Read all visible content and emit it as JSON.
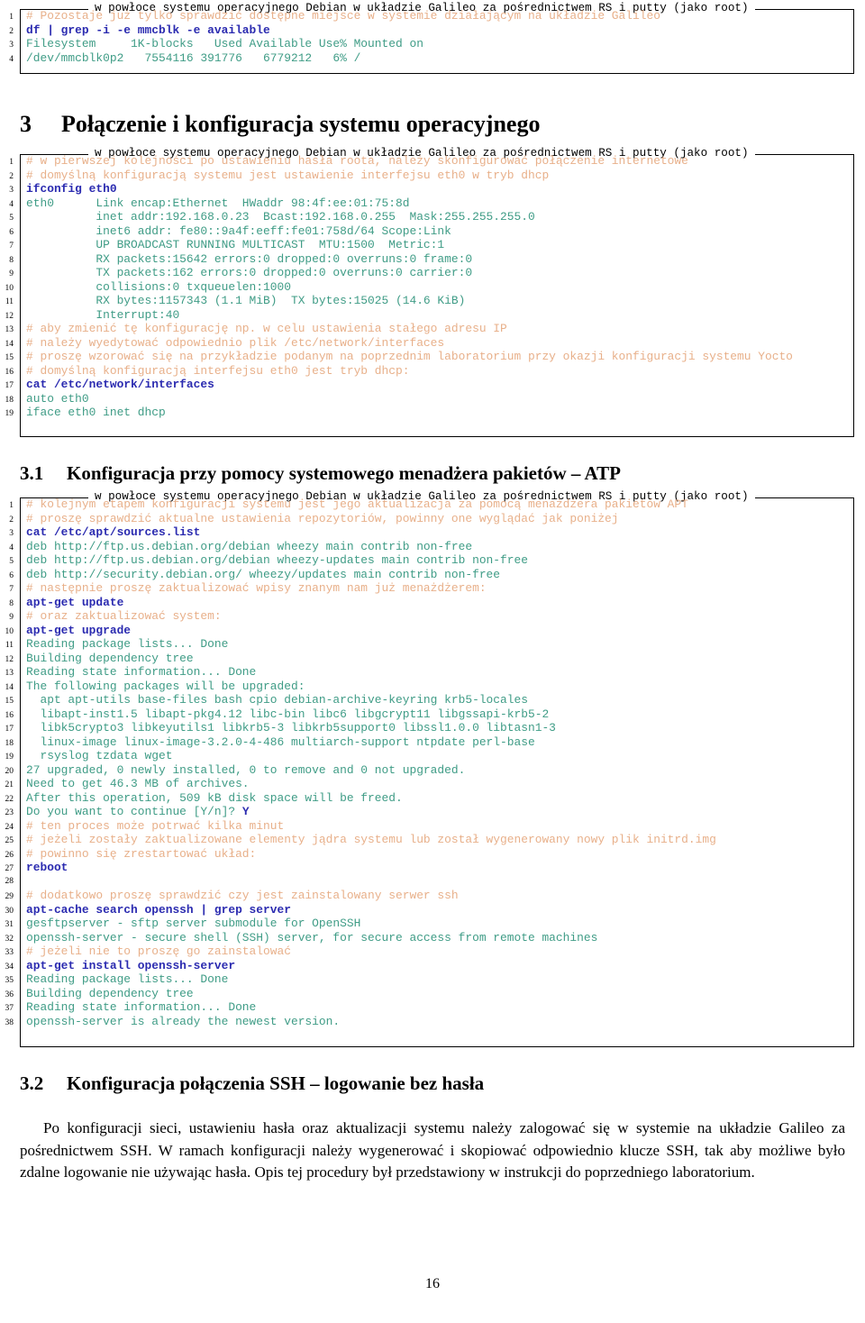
{
  "document": {
    "page_number": "16",
    "colors": {
      "comment": "#e8b08a",
      "command": "#2b2bb0",
      "output": "#3f9c86",
      "frame": "#000000",
      "text": "#000000"
    }
  },
  "listing_caption": "w powłoce systemu operacyjnego Debian w układzie Galileo za pośrednictwem RS i putty (jako root)",
  "listing_top": {
    "lines": [
      {
        "n": "1",
        "role": "comment",
        "text": "# Pozostaje już tylko sprawdzić dostępne miejsce w systemie działającym na układzie Galileo"
      },
      {
        "n": "2",
        "role": "cmd",
        "text": "df | grep -i -e mmcblk -e available"
      },
      {
        "n": "3",
        "role": "out",
        "text": "Filesystem     1K-blocks   Used Available Use% Mounted on"
      },
      {
        "n": "4",
        "role": "out",
        "text": "/dev/mmcblk0p2   7554116 391776   6779212   6% /"
      }
    ]
  },
  "section_3": {
    "number": "3",
    "title": "Połączenie i konfiguracja systemu operacyjnego"
  },
  "listing_ifconfig": {
    "lines": [
      {
        "n": "1",
        "role": "comment",
        "text": "# w pierwszej kolejności po ustawieniu hasła roota, należy skonfigurować połączenie internetowe"
      },
      {
        "n": "2",
        "role": "comment",
        "text": "# domyślną konfiguracją systemu jest ustawienie interfejsu eth0 w tryb dhcp"
      },
      {
        "n": "3",
        "role": "cmd",
        "text": "ifconfig eth0"
      },
      {
        "n": "4",
        "role": "out",
        "text": "eth0      Link encap:Ethernet  HWaddr 98:4f:ee:01:75:8d"
      },
      {
        "n": "5",
        "role": "out",
        "text": "          inet addr:192.168.0.23  Bcast:192.168.0.255  Mask:255.255.255.0"
      },
      {
        "n": "6",
        "role": "out",
        "text": "          inet6 addr: fe80::9a4f:eeff:fe01:758d/64 Scope:Link"
      },
      {
        "n": "7",
        "role": "out",
        "text": "          UP BROADCAST RUNNING MULTICAST  MTU:1500  Metric:1"
      },
      {
        "n": "8",
        "role": "out",
        "text": "          RX packets:15642 errors:0 dropped:0 overruns:0 frame:0"
      },
      {
        "n": "9",
        "role": "out",
        "text": "          TX packets:162 errors:0 dropped:0 overruns:0 carrier:0"
      },
      {
        "n": "10",
        "role": "out",
        "text": "          collisions:0 txqueuelen:1000"
      },
      {
        "n": "11",
        "role": "out",
        "text": "          RX bytes:1157343 (1.1 MiB)  TX bytes:15025 (14.6 KiB)"
      },
      {
        "n": "12",
        "role": "out",
        "text": "          Interrupt:40"
      },
      {
        "n": "13",
        "role": "comment",
        "text": "# aby zmienić tę konfigurację np. w celu ustawienia stałego adresu IP"
      },
      {
        "n": "14",
        "role": "comment",
        "text": "# należy wyedytować odpowiednio plik /etc/network/interfaces"
      },
      {
        "n": "15",
        "role": "comment",
        "text": "# proszę wzorować się na przykładzie podanym na poprzednim laboratorium przy okazji konfiguracji systemu Yocto"
      },
      {
        "n": "16",
        "role": "comment",
        "text": "# domyślną konfiguracją interfejsu eth0 jest tryb dhcp:"
      },
      {
        "n": "17",
        "role": "cmd",
        "text": "cat /etc/network/interfaces"
      },
      {
        "n": "18",
        "role": "out",
        "text": "auto eth0"
      },
      {
        "n": "19",
        "role": "out",
        "text": "iface eth0 inet dhcp"
      }
    ]
  },
  "section_3_1": {
    "number": "3.1",
    "title": "Konfiguracja przy pomocy systemowego menadżera pakietów – ATP"
  },
  "listing_apt": {
    "lines": [
      {
        "n": "1",
        "role": "comment",
        "text": "# kolejnym etapem konfiguracji systemu jest jego aktualizacja za pomocą menażdżera pakietów APT"
      },
      {
        "n": "2",
        "role": "comment",
        "text": "# proszę sprawdzić aktualne ustawienia repozytoriów, powinny one wyglądać jak poniżej"
      },
      {
        "n": "3",
        "role": "cmd",
        "text": "cat /etc/apt/sources.list"
      },
      {
        "n": "4",
        "role": "out",
        "text": "deb http://ftp.us.debian.org/debian wheezy main contrib non-free"
      },
      {
        "n": "5",
        "role": "out",
        "text": "deb http://ftp.us.debian.org/debian wheezy-updates main contrib non-free"
      },
      {
        "n": "6",
        "role": "out",
        "text": "deb http://security.debian.org/ wheezy/updates main contrib non-free"
      },
      {
        "n": "7",
        "role": "comment",
        "text": "# następnie proszę zaktualizować wpisy znanym nam już menażdżerem:"
      },
      {
        "n": "8",
        "role": "cmd",
        "text": "apt-get update"
      },
      {
        "n": "9",
        "role": "comment",
        "text": "# oraz zaktualizować system:"
      },
      {
        "n": "10",
        "role": "cmd",
        "text": "apt-get upgrade"
      },
      {
        "n": "11",
        "role": "out",
        "text": "Reading package lists... Done"
      },
      {
        "n": "12",
        "role": "out",
        "text": "Building dependency tree"
      },
      {
        "n": "13",
        "role": "out",
        "text": "Reading state information... Done"
      },
      {
        "n": "14",
        "role": "out",
        "text": "The following packages will be upgraded:"
      },
      {
        "n": "15",
        "role": "out",
        "text": "  apt apt-utils base-files bash cpio debian-archive-keyring krb5-locales"
      },
      {
        "n": "16",
        "role": "out",
        "text": "  libapt-inst1.5 libapt-pkg4.12 libc-bin libc6 libgcrypt11 libgssapi-krb5-2"
      },
      {
        "n": "17",
        "role": "out",
        "text": "  libk5crypto3 libkeyutils1 libkrb5-3 libkrb5support0 libssl1.0.0 libtasn1-3"
      },
      {
        "n": "18",
        "role": "out",
        "text": "  linux-image linux-image-3.2.0-4-486 multiarch-support ntpdate perl-base"
      },
      {
        "n": "19",
        "role": "out",
        "text": "  rsyslog tzdata wget"
      },
      {
        "n": "20",
        "role": "out",
        "text": "27 upgraded, 0 newly installed, 0 to remove and 0 not upgraded."
      },
      {
        "n": "21",
        "role": "out",
        "text": "Need to get 46.3 MB of archives."
      },
      {
        "n": "22",
        "role": "out",
        "text": "After this operation, 509 kB disk space will be freed."
      },
      {
        "n": "23",
        "role": "out-ans",
        "text": "Do you want to continue [Y/n]? ",
        "answer": "Y"
      },
      {
        "n": "24",
        "role": "comment",
        "text": "# ten proces może potrwać kilka minut"
      },
      {
        "n": "25",
        "role": "comment",
        "text": "# jeżeli zostały zaktualizowane elementy jądra systemu lub został wygenerowany nowy plik initrd.img"
      },
      {
        "n": "26",
        "role": "comment",
        "text": "# powinno się zrestartować układ:"
      },
      {
        "n": "27",
        "role": "cmd",
        "text": "reboot"
      },
      {
        "n": "28",
        "role": "out",
        "text": ""
      },
      {
        "n": "29",
        "role": "comment",
        "text": "# dodatkowo proszę sprawdzić czy jest zainstalowany serwer ssh"
      },
      {
        "n": "30",
        "role": "cmd",
        "text": "apt-cache search openssh | grep server"
      },
      {
        "n": "31",
        "role": "out",
        "text": "gesftpserver - sftp server submodule for OpenSSH"
      },
      {
        "n": "32",
        "role": "out",
        "text": "openssh-server - secure shell (SSH) server, for secure access from remote machines"
      },
      {
        "n": "33",
        "role": "comment",
        "text": "# jeżeli nie to proszę go zainstalować"
      },
      {
        "n": "34",
        "role": "cmd",
        "text": "apt-get install openssh-server"
      },
      {
        "n": "35",
        "role": "out",
        "text": "Reading package lists... Done"
      },
      {
        "n": "36",
        "role": "out",
        "text": "Building dependency tree"
      },
      {
        "n": "37",
        "role": "out",
        "text": "Reading state information... Done"
      },
      {
        "n": "38",
        "role": "out",
        "text": "openssh-server is already the newest version."
      }
    ]
  },
  "section_3_2": {
    "number": "3.2",
    "title": "Konfiguracja połączenia SSH – logowanie bez hasła",
    "paragraph": "Po konfiguracji sieci, ustawieniu hasła oraz aktualizacji systemu należy zalogować się w systemie na układzie Galileo za pośrednictwem SSH. W ramach konfiguracji należy wygenerować i skopiować odpowiednio klucze SSH, tak aby możliwe było zdalne logowanie nie używając hasła.  Opis tej procedury był przedstawiony w instrukcji do poprzedniego laboratorium."
  }
}
